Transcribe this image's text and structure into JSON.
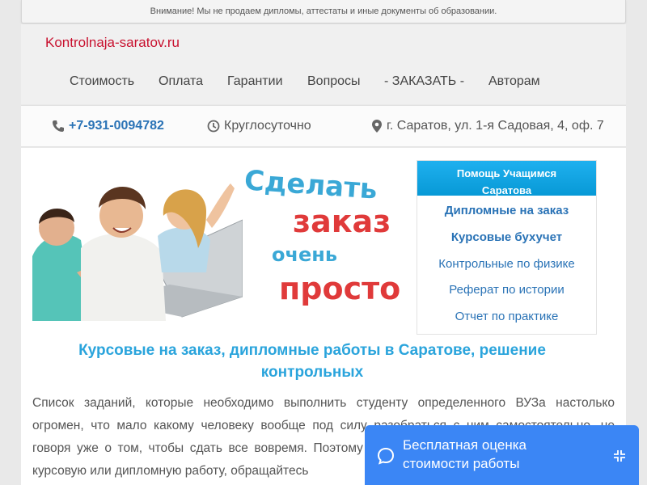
{
  "notice": "Внимание! Мы не продаем дипломы, аттестаты и иные документы об образовании.",
  "site_name": "Kontrolnaja-saratov.ru",
  "nav": [
    "Стоимость",
    "Оплата",
    "Гарантии",
    "Вопросы",
    "- ЗАКАЗАТЬ -",
    "Авторам"
  ],
  "contacts": {
    "phone": "+7-931-0094782",
    "hours": "Круглосуточно",
    "address": "г. Саратов, ул. 1-я Садовая, 4, оф. 7"
  },
  "banner": {
    "line1": "Сделать",
    "line2": "заказ",
    "line3": "очень",
    "line4": "просто"
  },
  "sidebar": {
    "title_line1": "Помощь Учащимся",
    "title_line2": "Саратова",
    "items": [
      "Дипломные на заказ",
      "Курсовые бухучет",
      "Контрольные по физике",
      "Реферат по истории",
      "Отчет по практике"
    ]
  },
  "heading_line1": "Курсовые на заказ, дипломные работы в Саратове, решение",
  "heading_line2": "контрольных",
  "paragraph": "Список заданий, которые необходимо выполнить студенту определенного ВУЗа настолько огромен, что мало какому человеку вообще под силу разобраться с ним самостоятельно, не говоря уже о том, чтобы сдать все вовремя. Поэтому многие студенты предпочитают заказать курсовую или дипломную работу, обращайтесь",
  "chat": {
    "line1": "Бесплатная оценка",
    "line2": "стоимости работы"
  },
  "colors": {
    "brand_red": "#c8102e",
    "link_blue": "#2a73b6",
    "accent_cyan": "#2aa4dc",
    "chat_blue": "#3b86f5"
  }
}
